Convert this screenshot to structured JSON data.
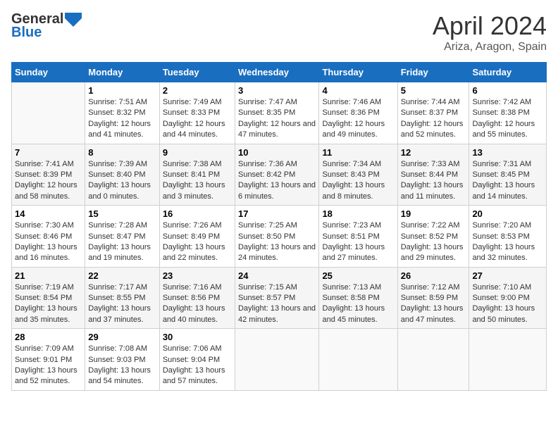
{
  "header": {
    "logo_line1": "General",
    "logo_line2": "Blue",
    "month": "April 2024",
    "location": "Ariza, Aragon, Spain"
  },
  "days_of_week": [
    "Sunday",
    "Monday",
    "Tuesday",
    "Wednesday",
    "Thursday",
    "Friday",
    "Saturday"
  ],
  "weeks": [
    [
      {
        "day": "",
        "sunrise": "",
        "sunset": "",
        "daylight": ""
      },
      {
        "day": "1",
        "sunrise": "Sunrise: 7:51 AM",
        "sunset": "Sunset: 8:32 PM",
        "daylight": "Daylight: 12 hours and 41 minutes."
      },
      {
        "day": "2",
        "sunrise": "Sunrise: 7:49 AM",
        "sunset": "Sunset: 8:33 PM",
        "daylight": "Daylight: 12 hours and 44 minutes."
      },
      {
        "day": "3",
        "sunrise": "Sunrise: 7:47 AM",
        "sunset": "Sunset: 8:35 PM",
        "daylight": "Daylight: 12 hours and 47 minutes."
      },
      {
        "day": "4",
        "sunrise": "Sunrise: 7:46 AM",
        "sunset": "Sunset: 8:36 PM",
        "daylight": "Daylight: 12 hours and 49 minutes."
      },
      {
        "day": "5",
        "sunrise": "Sunrise: 7:44 AM",
        "sunset": "Sunset: 8:37 PM",
        "daylight": "Daylight: 12 hours and 52 minutes."
      },
      {
        "day": "6",
        "sunrise": "Sunrise: 7:42 AM",
        "sunset": "Sunset: 8:38 PM",
        "daylight": "Daylight: 12 hours and 55 minutes."
      }
    ],
    [
      {
        "day": "7",
        "sunrise": "Sunrise: 7:41 AM",
        "sunset": "Sunset: 8:39 PM",
        "daylight": "Daylight: 12 hours and 58 minutes."
      },
      {
        "day": "8",
        "sunrise": "Sunrise: 7:39 AM",
        "sunset": "Sunset: 8:40 PM",
        "daylight": "Daylight: 13 hours and 0 minutes."
      },
      {
        "day": "9",
        "sunrise": "Sunrise: 7:38 AM",
        "sunset": "Sunset: 8:41 PM",
        "daylight": "Daylight: 13 hours and 3 minutes."
      },
      {
        "day": "10",
        "sunrise": "Sunrise: 7:36 AM",
        "sunset": "Sunset: 8:42 PM",
        "daylight": "Daylight: 13 hours and 6 minutes."
      },
      {
        "day": "11",
        "sunrise": "Sunrise: 7:34 AM",
        "sunset": "Sunset: 8:43 PM",
        "daylight": "Daylight: 13 hours and 8 minutes."
      },
      {
        "day": "12",
        "sunrise": "Sunrise: 7:33 AM",
        "sunset": "Sunset: 8:44 PM",
        "daylight": "Daylight: 13 hours and 11 minutes."
      },
      {
        "day": "13",
        "sunrise": "Sunrise: 7:31 AM",
        "sunset": "Sunset: 8:45 PM",
        "daylight": "Daylight: 13 hours and 14 minutes."
      }
    ],
    [
      {
        "day": "14",
        "sunrise": "Sunrise: 7:30 AM",
        "sunset": "Sunset: 8:46 PM",
        "daylight": "Daylight: 13 hours and 16 minutes."
      },
      {
        "day": "15",
        "sunrise": "Sunrise: 7:28 AM",
        "sunset": "Sunset: 8:47 PM",
        "daylight": "Daylight: 13 hours and 19 minutes."
      },
      {
        "day": "16",
        "sunrise": "Sunrise: 7:26 AM",
        "sunset": "Sunset: 8:49 PM",
        "daylight": "Daylight: 13 hours and 22 minutes."
      },
      {
        "day": "17",
        "sunrise": "Sunrise: 7:25 AM",
        "sunset": "Sunset: 8:50 PM",
        "daylight": "Daylight: 13 hours and 24 minutes."
      },
      {
        "day": "18",
        "sunrise": "Sunrise: 7:23 AM",
        "sunset": "Sunset: 8:51 PM",
        "daylight": "Daylight: 13 hours and 27 minutes."
      },
      {
        "day": "19",
        "sunrise": "Sunrise: 7:22 AM",
        "sunset": "Sunset: 8:52 PM",
        "daylight": "Daylight: 13 hours and 29 minutes."
      },
      {
        "day": "20",
        "sunrise": "Sunrise: 7:20 AM",
        "sunset": "Sunset: 8:53 PM",
        "daylight": "Daylight: 13 hours and 32 minutes."
      }
    ],
    [
      {
        "day": "21",
        "sunrise": "Sunrise: 7:19 AM",
        "sunset": "Sunset: 8:54 PM",
        "daylight": "Daylight: 13 hours and 35 minutes."
      },
      {
        "day": "22",
        "sunrise": "Sunrise: 7:17 AM",
        "sunset": "Sunset: 8:55 PM",
        "daylight": "Daylight: 13 hours and 37 minutes."
      },
      {
        "day": "23",
        "sunrise": "Sunrise: 7:16 AM",
        "sunset": "Sunset: 8:56 PM",
        "daylight": "Daylight: 13 hours and 40 minutes."
      },
      {
        "day": "24",
        "sunrise": "Sunrise: 7:15 AM",
        "sunset": "Sunset: 8:57 PM",
        "daylight": "Daylight: 13 hours and 42 minutes."
      },
      {
        "day": "25",
        "sunrise": "Sunrise: 7:13 AM",
        "sunset": "Sunset: 8:58 PM",
        "daylight": "Daylight: 13 hours and 45 minutes."
      },
      {
        "day": "26",
        "sunrise": "Sunrise: 7:12 AM",
        "sunset": "Sunset: 8:59 PM",
        "daylight": "Daylight: 13 hours and 47 minutes."
      },
      {
        "day": "27",
        "sunrise": "Sunrise: 7:10 AM",
        "sunset": "Sunset: 9:00 PM",
        "daylight": "Daylight: 13 hours and 50 minutes."
      }
    ],
    [
      {
        "day": "28",
        "sunrise": "Sunrise: 7:09 AM",
        "sunset": "Sunset: 9:01 PM",
        "daylight": "Daylight: 13 hours and 52 minutes."
      },
      {
        "day": "29",
        "sunrise": "Sunrise: 7:08 AM",
        "sunset": "Sunset: 9:03 PM",
        "daylight": "Daylight: 13 hours and 54 minutes."
      },
      {
        "day": "30",
        "sunrise": "Sunrise: 7:06 AM",
        "sunset": "Sunset: 9:04 PM",
        "daylight": "Daylight: 13 hours and 57 minutes."
      },
      {
        "day": "",
        "sunrise": "",
        "sunset": "",
        "daylight": ""
      },
      {
        "day": "",
        "sunrise": "",
        "sunset": "",
        "daylight": ""
      },
      {
        "day": "",
        "sunrise": "",
        "sunset": "",
        "daylight": ""
      },
      {
        "day": "",
        "sunrise": "",
        "sunset": "",
        "daylight": ""
      }
    ]
  ]
}
